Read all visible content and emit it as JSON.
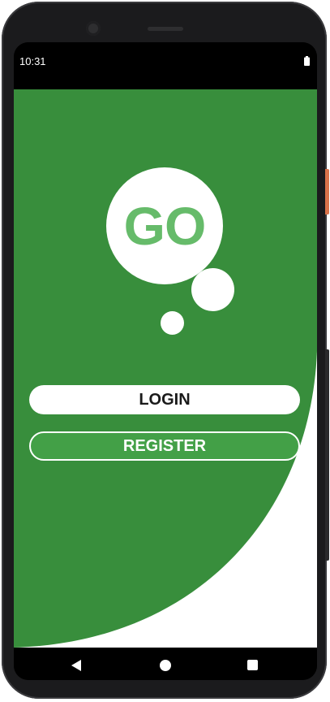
{
  "status_bar": {
    "time": "10:31",
    "battery_icon": "battery-full-icon"
  },
  "logo": {
    "text": "GO",
    "text_color": "#66bb6a"
  },
  "buttons": {
    "login_label": "LOGIN",
    "register_label": "REGISTER"
  },
  "nav_bar": {
    "back_icon": "back-triangle-icon",
    "home_icon": "home-circle-icon",
    "recent_icon": "recent-apps-square-icon"
  },
  "colors": {
    "primary_green": "#388e3c",
    "register_fill": "#43a047",
    "logo_green": "#66bb6a",
    "background": "#ffffff"
  }
}
